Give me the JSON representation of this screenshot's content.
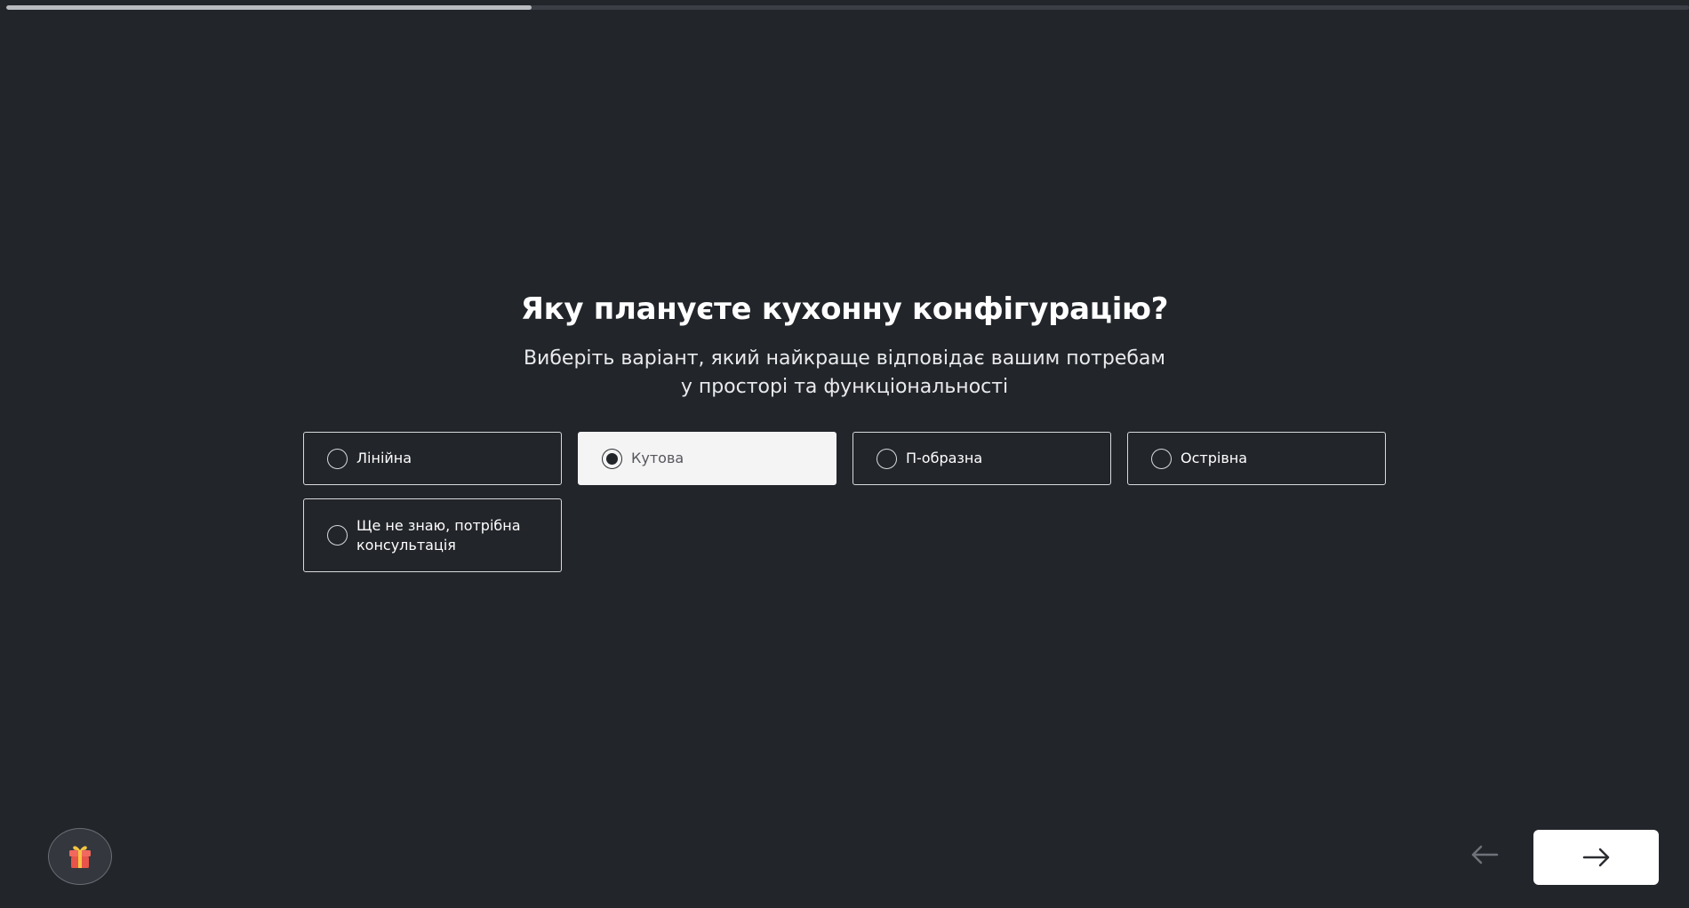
{
  "progress": {
    "value": 0.312
  },
  "question": {
    "title": "Яку плануєте кухонну конфігурацію?",
    "subtitle_line1": "Виберіть варіант, який найкраще відповідає вашим потребам",
    "subtitle_line2": "у просторі та функціональності"
  },
  "options": [
    {
      "label": "Лінійна",
      "selected": false
    },
    {
      "label": "Кутова",
      "selected": true
    },
    {
      "label": "П-образна",
      "selected": false
    },
    {
      "label": "Острівна",
      "selected": false
    },
    {
      "label_line1": "Ще не знаю, потрібна",
      "label_line2": "консультація",
      "selected": false
    }
  ],
  "icons": {
    "gift": "gift-icon",
    "prev": "arrow-left-icon",
    "next": "arrow-right-icon"
  },
  "colors": {
    "background": "#22252a",
    "selected_option": "#f4f4f5",
    "border": "#d8d9db",
    "gift_red": "#e8534a",
    "gift_ribbon": "#f5c542"
  }
}
